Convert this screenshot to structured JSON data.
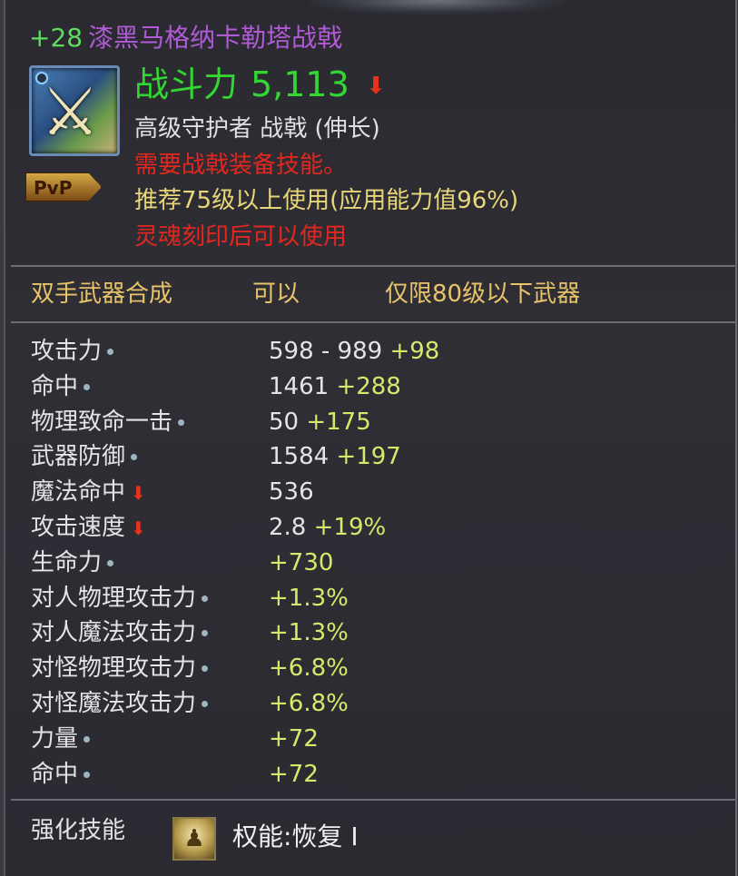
{
  "item": {
    "enhance": "+28",
    "name": "漆黑马格纳卡勒塔战戟",
    "icon": "halberd-icon",
    "badge": "PvP",
    "power_label": "战斗力",
    "power_value": "5,113",
    "power_trend_icon": "down-arrow-icon",
    "subtitle": "高级守护者 战戟 (伸长)",
    "requirement": "需要战戟装备技能。",
    "recommend": "推荐75级以上使用(应用能力值96%)",
    "soul": "灵魂刻印后可以使用"
  },
  "synthesis": {
    "label": "双手武器合成",
    "status": "可以",
    "note": "仅限80级以下武器"
  },
  "stats": [
    {
      "label": "攻击力",
      "marker": "dot",
      "base": "598 - 989 ",
      "bonus": "+98"
    },
    {
      "label": "命中",
      "marker": "dot",
      "base": "1461 ",
      "bonus": "+288"
    },
    {
      "label": "物理致命一击",
      "marker": "dot",
      "base": "50 ",
      "bonus": "+175"
    },
    {
      "label": "武器防御",
      "marker": "dot",
      "base": "1584 ",
      "bonus": "+197"
    },
    {
      "label": "魔法命中",
      "marker": "down",
      "base": "536",
      "bonus": ""
    },
    {
      "label": "攻击速度",
      "marker": "down",
      "base": "2.8 ",
      "bonus": "+19%"
    },
    {
      "label": "生命力",
      "marker": "dot",
      "base": "",
      "bonus": "+730"
    },
    {
      "label": "对人物理攻击力",
      "marker": "dot",
      "base": "",
      "bonus": "+1.3%"
    },
    {
      "label": "对人魔法攻击力",
      "marker": "dot",
      "base": "",
      "bonus": "+1.3%"
    },
    {
      "label": "对怪物理攻击力",
      "marker": "dot",
      "base": "",
      "bonus": "+6.8%"
    },
    {
      "label": "对怪魔法攻击力",
      "marker": "dot",
      "base": "",
      "bonus": "+6.8%"
    },
    {
      "label": "力量",
      "marker": "dot",
      "base": "",
      "bonus": "+72"
    },
    {
      "label": "命中",
      "marker": "dot",
      "base": "",
      "bonus": "+72"
    }
  ],
  "skill": {
    "label": "强化技能",
    "icon": "warrior-skill-icon",
    "name": "权能:恢复 I"
  },
  "colors": {
    "enhance": "#5fdc5f",
    "name": "#b05bd6",
    "power": "#33d633",
    "warning": "#e3271f",
    "recommend": "#e8d67a",
    "synthesis": "#e8c36a",
    "bonus": "#d8e86a"
  }
}
